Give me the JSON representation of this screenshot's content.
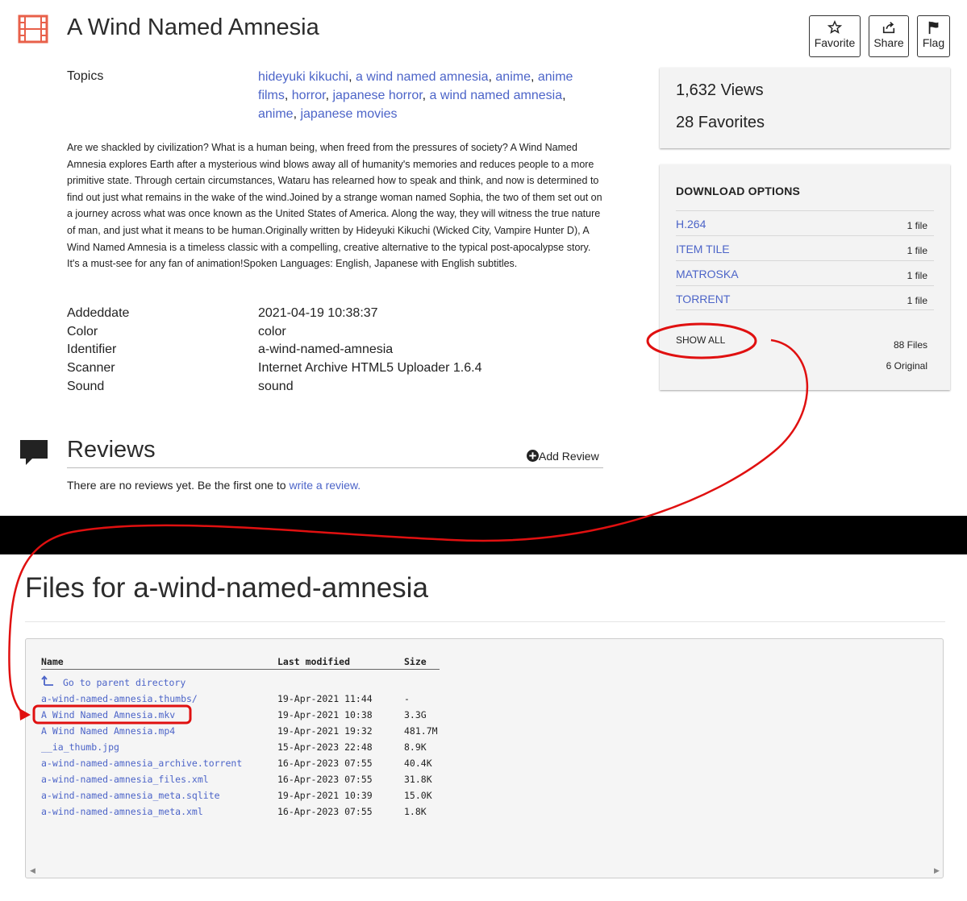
{
  "item": {
    "title": "A Wind Named Amnesia",
    "buttons": {
      "favorite": "Favorite",
      "share": "Share",
      "flag": "Flag"
    },
    "topics_label": "Topics",
    "topics": [
      "hideyuki kikuchi",
      "a wind named amnesia",
      "anime",
      "anime films",
      "horror",
      "japanese horror",
      "a wind named amnesia",
      "anime",
      "japanese movies"
    ],
    "description": "Are we shackled by civilization? What is a human being, when freed from the pressures of society? A Wind Named Amnesia explores Earth after a mysterious wind blows away all of humanity's memories and reduces people to a more primitive state. Through certain circumstances, Wataru has relearned how to speak and think, and now is determined to find out just what remains in the wake of the wind.Joined by a strange woman named Sophia, the two of them set out on a journey across what was once known as the United States of America. Along the way, they will witness the true nature of man, and just what it means to be human.Originally written by Hideyuki Kikuchi (Wicked City, Vampire Hunter D), A Wind Named Amnesia is a timeless classic with a compelling, creative alternative to the typical post-apocalypse story. It's a must-see for any fan of animation!Spoken Languages: English, Japanese with English subtitles.",
    "metadata": [
      {
        "key": "Addeddate",
        "value": "2021-04-19 10:38:37"
      },
      {
        "key": "Color",
        "value": "color"
      },
      {
        "key": "Identifier",
        "value": "a-wind-named-amnesia"
      },
      {
        "key": "Scanner",
        "value": "Internet Archive HTML5 Uploader 1.6.4"
      },
      {
        "key": "Sound",
        "value": "sound"
      }
    ],
    "views": "1,632 Views",
    "favorites": "28 Favorites"
  },
  "downloads": {
    "heading": "DOWNLOAD OPTIONS",
    "options": [
      {
        "format": "H.264",
        "count": "1 file"
      },
      {
        "format": "ITEM TILE",
        "count": "1 file"
      },
      {
        "format": "MATROSKA",
        "count": "1 file"
      },
      {
        "format": "TORRENT",
        "count": "1 file"
      }
    ],
    "show_all": "SHOW ALL",
    "total_files": "88 Files",
    "original_files": "6 Original"
  },
  "reviews": {
    "title": "Reviews",
    "add_review": "Add Review",
    "empty_prefix": "There are no reviews yet. Be the first one to ",
    "empty_link": "write a review."
  },
  "files": {
    "title": "Files for a-wind-named-amnesia",
    "columns": {
      "name": "Name",
      "modified": "Last modified",
      "size": "Size"
    },
    "parent_label": "Go to parent directory",
    "rows": [
      {
        "name": "a-wind-named-amnesia.thumbs/",
        "modified": "19-Apr-2021 11:44",
        "size": "-"
      },
      {
        "name": "A Wind Named Amnesia.mkv",
        "modified": "19-Apr-2021 10:38",
        "size": "3.3G"
      },
      {
        "name": "A Wind Named Amnesia.mp4",
        "modified": "19-Apr-2021 19:32",
        "size": "481.7M"
      },
      {
        "name": "__ia_thumb.jpg",
        "modified": "15-Apr-2023 22:48",
        "size": "8.9K"
      },
      {
        "name": "a-wind-named-amnesia_archive.torrent",
        "modified": "16-Apr-2023 07:55",
        "size": "40.4K"
      },
      {
        "name": "a-wind-named-amnesia_files.xml",
        "modified": "16-Apr-2023 07:55",
        "size": "31.8K"
      },
      {
        "name": "a-wind-named-amnesia_meta.sqlite",
        "modified": "19-Apr-2021 10:39",
        "size": "15.0K"
      },
      {
        "name": "a-wind-named-amnesia_meta.xml",
        "modified": "16-Apr-2023 07:55",
        "size": "1.8K"
      }
    ]
  },
  "colors": {
    "link": "#4c64c8",
    "annotation": "#e01010",
    "icon_film": "#e8604a"
  },
  "icons": [
    "film-icon",
    "star-icon",
    "share-icon",
    "flag-icon",
    "speech-bubble-icon",
    "plus-circle-icon",
    "up-arrow-icon"
  ]
}
